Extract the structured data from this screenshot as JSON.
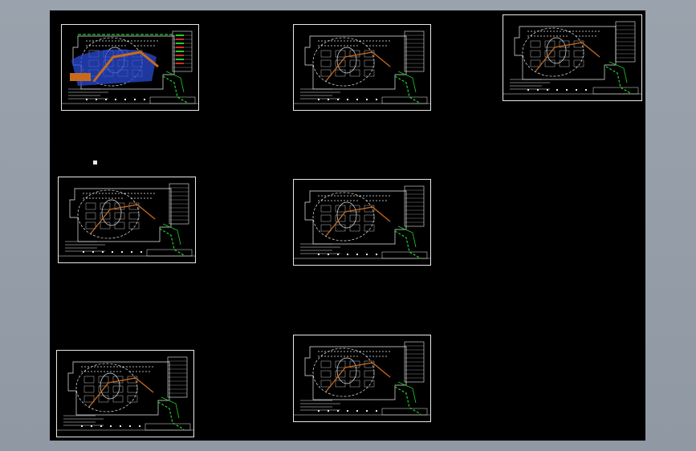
{
  "view": {
    "background_color": "#000000",
    "surround_color": "#939ca7",
    "line_color": "#e8e8e8",
    "accent_colors": {
      "pipe": "#c86a1e",
      "green": "#1fd12a",
      "blue": "#2a4bd6",
      "red": "#d42a2a"
    }
  },
  "sheets": [
    {
      "id": "sheet-1",
      "variant": "colored"
    },
    {
      "id": "sheet-2",
      "variant": "plain"
    },
    {
      "id": "sheet-3",
      "variant": "plain"
    },
    {
      "id": "sheet-4",
      "variant": "plain"
    },
    {
      "id": "sheet-5",
      "variant": "plain"
    },
    {
      "id": "sheet-6",
      "variant": "plain"
    },
    {
      "id": "sheet-7",
      "variant": "plain"
    }
  ]
}
